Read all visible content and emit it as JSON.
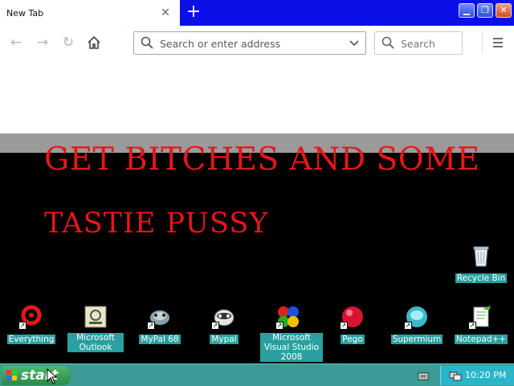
{
  "browser": {
    "tab_title": "New Tab",
    "tab_close_icon": "close-icon",
    "new_tab_icon": "plus-icon",
    "window_controls": [
      "minimize",
      "maximize",
      "close"
    ],
    "address_placeholder": "Search or enter address",
    "search_placeholder": "Search"
  },
  "wallpaper": {
    "line1": "GET BITCHES AND SOME",
    "line2": "TASTIE PUSSY",
    "text_color": "#e8151a"
  },
  "desktop_icons": [
    {
      "label": "Recycle Bin",
      "icon": "recycle-bin-icon"
    },
    {
      "label": "Everything",
      "icon": "everything-icon"
    },
    {
      "label": "Microsoft Outlook",
      "icon": "outlook-icon"
    },
    {
      "label": "MyPal 68",
      "icon": "mypal68-icon"
    },
    {
      "label": "Mypal",
      "icon": "mypal-icon"
    },
    {
      "label": "Microsoft Visual Studio 2008",
      "icon": "visual-studio-icon"
    },
    {
      "label": "Pego",
      "icon": "pego-icon"
    },
    {
      "label": "Supermium",
      "icon": "supermium-icon"
    },
    {
      "label": "Notepad++",
      "icon": "notepadpp-icon"
    }
  ],
  "taskbar": {
    "start_label": "start",
    "clock": "10:20 PM",
    "color": "#3d9a94"
  }
}
